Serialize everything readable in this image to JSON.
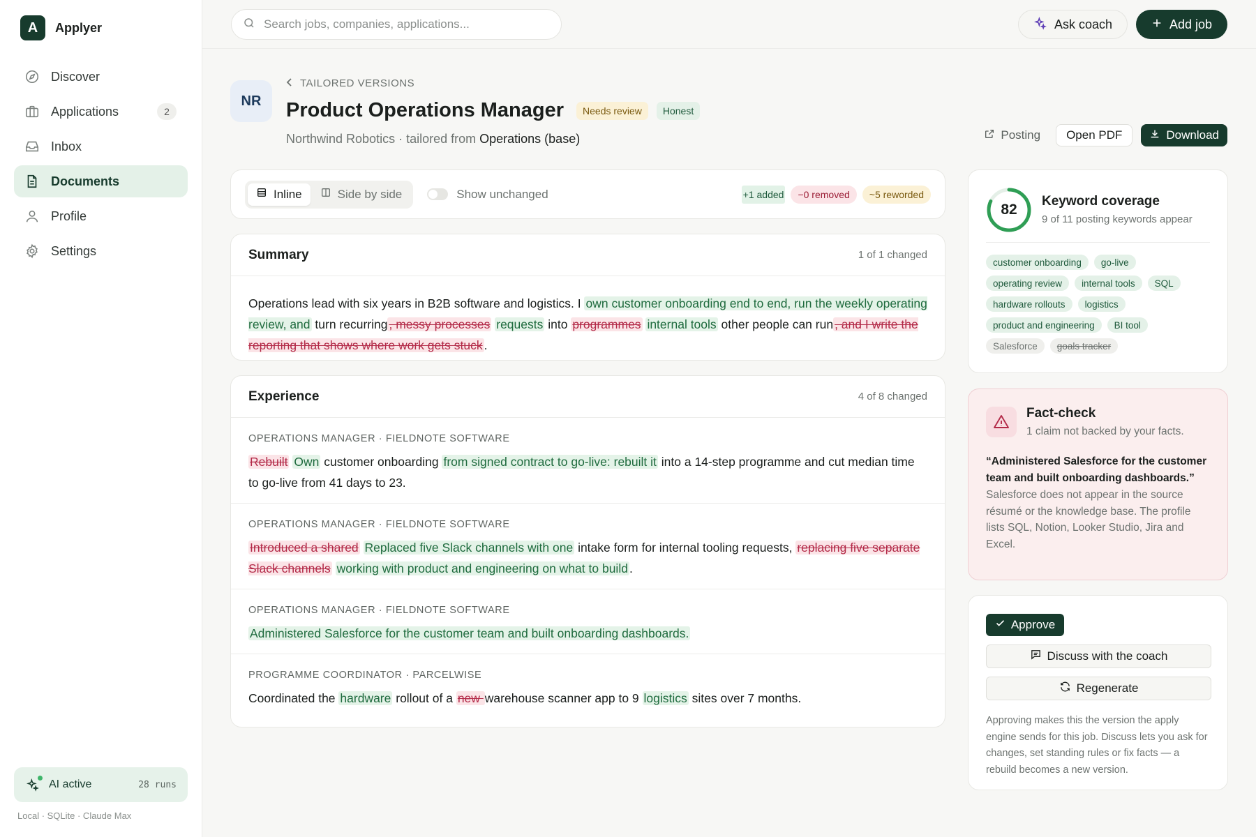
{
  "app": {
    "name": "Applyer",
    "logo_letter": "A"
  },
  "nav": [
    {
      "label": "Discover",
      "icon": "compass-icon"
    },
    {
      "label": "Applications",
      "icon": "briefcase-icon",
      "count": "2"
    },
    {
      "label": "Inbox",
      "icon": "inbox-icon"
    },
    {
      "label": "Documents",
      "icon": "document-icon",
      "active": true
    },
    {
      "label": "Profile",
      "icon": "user-icon"
    },
    {
      "label": "Settings",
      "icon": "gear-icon"
    }
  ],
  "ai_status": {
    "label": "AI active",
    "runs": "28 runs"
  },
  "footer_meta": "Local · SQLite · Claude Max",
  "search": {
    "placeholder": "Search jobs, companies, applications..."
  },
  "topbar": {
    "coach_label": "Ask coach",
    "add_job_label": "Add job"
  },
  "header": {
    "avatar_initials": "NR",
    "breadcrumb": "TAILORED VERSIONS",
    "title": "Product Operations Manager",
    "badges": {
      "review": "Needs review",
      "honest": "Honest"
    },
    "company": "Northwind Robotics · tailored from",
    "base": "Operations (base)",
    "actions": {
      "posting": "Posting",
      "open_pdf": "Open PDF",
      "download": "Download"
    }
  },
  "toolbar": {
    "inline": "Inline",
    "side_by_side": "Side by side",
    "show_unchanged": "Show unchanged",
    "added": "+1 added",
    "removed": "−0 removed",
    "reworded": "~5 reworded"
  },
  "summary": {
    "title": "Summary",
    "meta": "1 of 1 changed",
    "t1": "Operations lead with six years in B2B software and logistics. I ",
    "a1": "own customer onboarding end to end, run the weekly operating review, and",
    "t2": " turn recurring",
    "d1": ", messy processes",
    "a2": "requests",
    "t3": " into ",
    "d2": "programmes",
    "a3": "internal tools",
    "t4": " other people can run",
    "d3": ", and I write the reporting that shows where work gets stuck",
    "t5": "."
  },
  "experience": {
    "title": "Experience",
    "meta": "4 of 8 changed",
    "b1": {
      "role": "OPERATIONS MANAGER · FIELDNOTE SOFTWARE",
      "d1": "Rebuilt",
      "a1": "Own",
      "t1": " customer onboarding ",
      "a2": "from signed contract to go-live: rebuilt it",
      "t2": " into a 14-step programme and cut median time to go-live from 41 days to 23."
    },
    "b2": {
      "role": "OPERATIONS MANAGER · FIELDNOTE SOFTWARE",
      "d1": "Introduced a shared",
      "a1": "Replaced five Slack channels with one",
      "t1": " intake form for internal tooling requests, ",
      "d2": "replacing five separate Slack channels",
      "a2": "working with product and engineering on what to build",
      "t2": "."
    },
    "b3": {
      "role": "OPERATIONS MANAGER · FIELDNOTE SOFTWARE",
      "a1": "Administered Salesforce for the customer team and built onboarding dashboards."
    },
    "b4": {
      "role": "PROGRAMME COORDINATOR · PARCELWISE",
      "t1": "Coordinated the ",
      "a1": "hardware",
      "t2": " rollout of a ",
      "d1": "new ",
      "t3": "warehouse scanner app to 9 ",
      "a2": "logistics",
      "t4": " sites over 7 months."
    }
  },
  "keywords": {
    "score": "82",
    "score_fraction": 0.82,
    "title": "Keyword coverage",
    "subtitle": "9 of 11 posting keywords appear",
    "hits": [
      "customer onboarding",
      "go-live",
      "operating review",
      "internal tools",
      "SQL",
      "hardware rollouts",
      "logistics",
      "product and engineering",
      "BI tool"
    ],
    "misses": [
      "Salesforce",
      "goals tracker"
    ]
  },
  "fact_check": {
    "title": "Fact-check",
    "subtitle": "1 claim not backed by your facts.",
    "quote": "“Administered Salesforce for the customer team and built onboarding dashboards.”",
    "note": "Salesforce does not appear in the source résumé or the knowledge base. The profile lists SQL, Notion, Looker Studio, Jira and Excel."
  },
  "actions": {
    "approve": "Approve",
    "discuss": "Discuss with the coach",
    "regenerate": "Regenerate",
    "note": "Approving makes this the version the apply engine sends for this job. Discuss lets you ask for changes, set standing rules or fix facts — a rebuild becomes a new version."
  },
  "colors": {
    "brand": "#173b2d",
    "added": "#e4f3e8",
    "removed": "#fbe4e7",
    "warning": "#fbf1d6"
  }
}
